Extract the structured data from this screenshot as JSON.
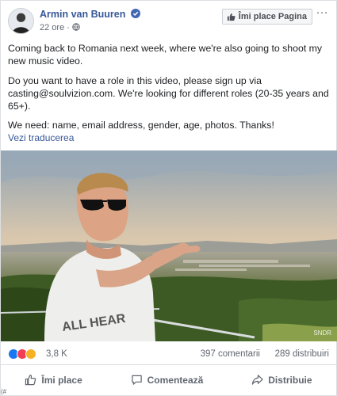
{
  "post": {
    "author": "Armin van Buuren",
    "time": "22 ore",
    "like_page_label": "Îmi place Pagina",
    "more_glyph": "···",
    "paragraphs": [
      "Coming back to Romania next week, where we're also going to shoot my new music video.",
      "Do you want to have a role in this video, please sign up via casting@soulvizion.com. We're looking for different roles (20-35 years and 65+).",
      "We need: name, email address, gender, age, photos. Thanks!"
    ],
    "see_translation": "Vezi traducerea",
    "photo_watermark": "SNDR"
  },
  "stats": {
    "reactions": "3,8 K",
    "comments": "397 comentarii",
    "shares": "289 distribuiri"
  },
  "actions": {
    "like": "Îmi place",
    "comment": "Comentează",
    "share": "Distribuie"
  },
  "icons": {
    "verified": "verified-badge-icon",
    "audience": "public-globe-icon",
    "reactions": [
      "like-reaction-icon",
      "love-reaction-icon",
      "wow-reaction-icon"
    ]
  },
  "colors": {
    "link": "#385898",
    "secondary_text": "#606770",
    "like_blue": "#1877f2",
    "love_red": "#f33e58",
    "wow_yellow": "#f7b125"
  },
  "corner_glyph": "(#"
}
